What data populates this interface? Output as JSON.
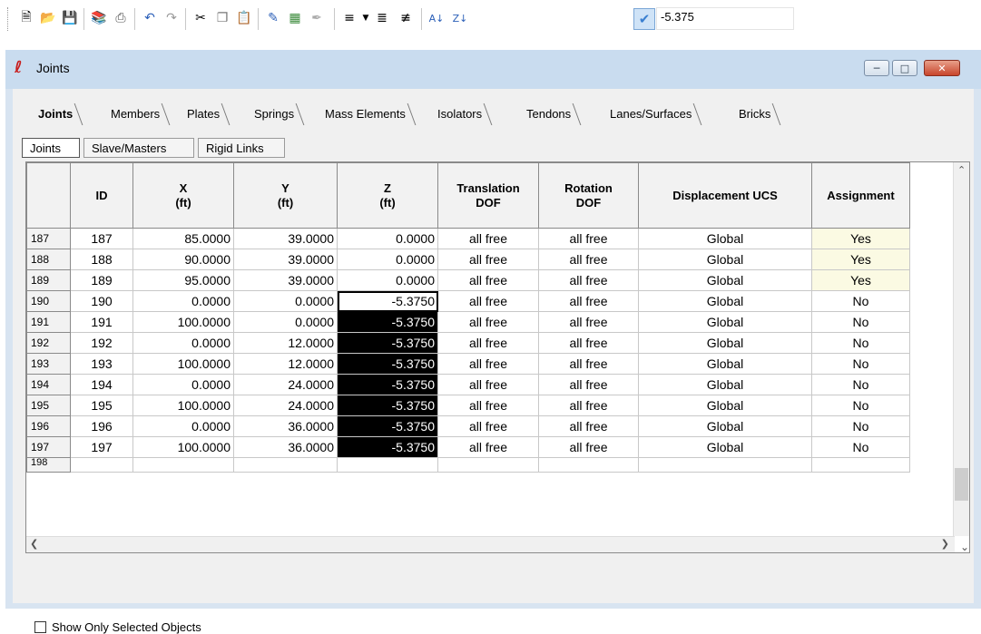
{
  "toolbar": {
    "icons": [
      "new-file-icon",
      "open-folder-icon",
      "save-icon",
      "book-icon",
      "print-icon",
      "undo-icon",
      "redo-icon",
      "cut-icon",
      "copy-icon",
      "paste-icon",
      "edit-icon",
      "table-icon",
      "pen-icon",
      "insert-rows-icon",
      "dropdown-arrow-icon",
      "insert-before-icon",
      "insert-after-icon",
      "sort-ascending-icon",
      "sort-descending-icon",
      "apply-check-icon"
    ],
    "value": "-5.375"
  },
  "window": {
    "title": "Joints",
    "controls": [
      "minimize",
      "restore",
      "close"
    ]
  },
  "tabs": [
    "Joints",
    "Members",
    "Plates",
    "Springs",
    "Mass Elements",
    "Isolators",
    "Tendons",
    "Lanes/Surfaces",
    "Bricks"
  ],
  "active_tab": "Joints",
  "subtabs": [
    "Joints",
    "Slave/Masters",
    "Rigid Links"
  ],
  "active_subtab": "Joints",
  "grid": {
    "headers": {
      "id": "ID",
      "x": "X",
      "y": "Y",
      "z": "Z",
      "unit": "(ft)",
      "translation_1": "Translation",
      "translation_2": "DOF",
      "rotation_1": "Rotation",
      "rotation_2": "DOF",
      "ucs": "Displacement UCS",
      "assignment": "Assignment"
    },
    "rows": [
      {
        "row": "187",
        "id": "187",
        "x": "85.0000",
        "y": "39.0000",
        "z": "0.0000",
        "t": "all free",
        "r": "all free",
        "ucs": "Global",
        "a": "Yes"
      },
      {
        "row": "188",
        "id": "188",
        "x": "90.0000",
        "y": "39.0000",
        "z": "0.0000",
        "t": "all free",
        "r": "all free",
        "ucs": "Global",
        "a": "Yes"
      },
      {
        "row": "189",
        "id": "189",
        "x": "95.0000",
        "y": "39.0000",
        "z": "0.0000",
        "t": "all free",
        "r": "all free",
        "ucs": "Global",
        "a": "Yes"
      },
      {
        "row": "190",
        "id": "190",
        "x": "0.0000",
        "y": "0.0000",
        "z": "-5.3750",
        "t": "all free",
        "r": "all free",
        "ucs": "Global",
        "a": "No"
      },
      {
        "row": "191",
        "id": "191",
        "x": "100.0000",
        "y": "0.0000",
        "z": "-5.3750",
        "t": "all free",
        "r": "all free",
        "ucs": "Global",
        "a": "No"
      },
      {
        "row": "192",
        "id": "192",
        "x": "0.0000",
        "y": "12.0000",
        "z": "-5.3750",
        "t": "all free",
        "r": "all free",
        "ucs": "Global",
        "a": "No"
      },
      {
        "row": "193",
        "id": "193",
        "x": "100.0000",
        "y": "12.0000",
        "z": "-5.3750",
        "t": "all free",
        "r": "all free",
        "ucs": "Global",
        "a": "No"
      },
      {
        "row": "194",
        "id": "194",
        "x": "0.0000",
        "y": "24.0000",
        "z": "-5.3750",
        "t": "all free",
        "r": "all free",
        "ucs": "Global",
        "a": "No"
      },
      {
        "row": "195",
        "id": "195",
        "x": "100.0000",
        "y": "24.0000",
        "z": "-5.3750",
        "t": "all free",
        "r": "all free",
        "ucs": "Global",
        "a": "No"
      },
      {
        "row": "196",
        "id": "196",
        "x": "0.0000",
        "y": "36.0000",
        "z": "-5.3750",
        "t": "all free",
        "r": "all free",
        "ucs": "Global",
        "a": "No"
      },
      {
        "row": "197",
        "id": "197",
        "x": "100.0000",
        "y": "36.0000",
        "z": "-5.3750",
        "t": "all free",
        "r": "all free",
        "ucs": "Global",
        "a": "No"
      }
    ],
    "partial_row": "198"
  },
  "footer": {
    "show_only_selected_label": "Show Only Selected Objects",
    "checked": false
  }
}
